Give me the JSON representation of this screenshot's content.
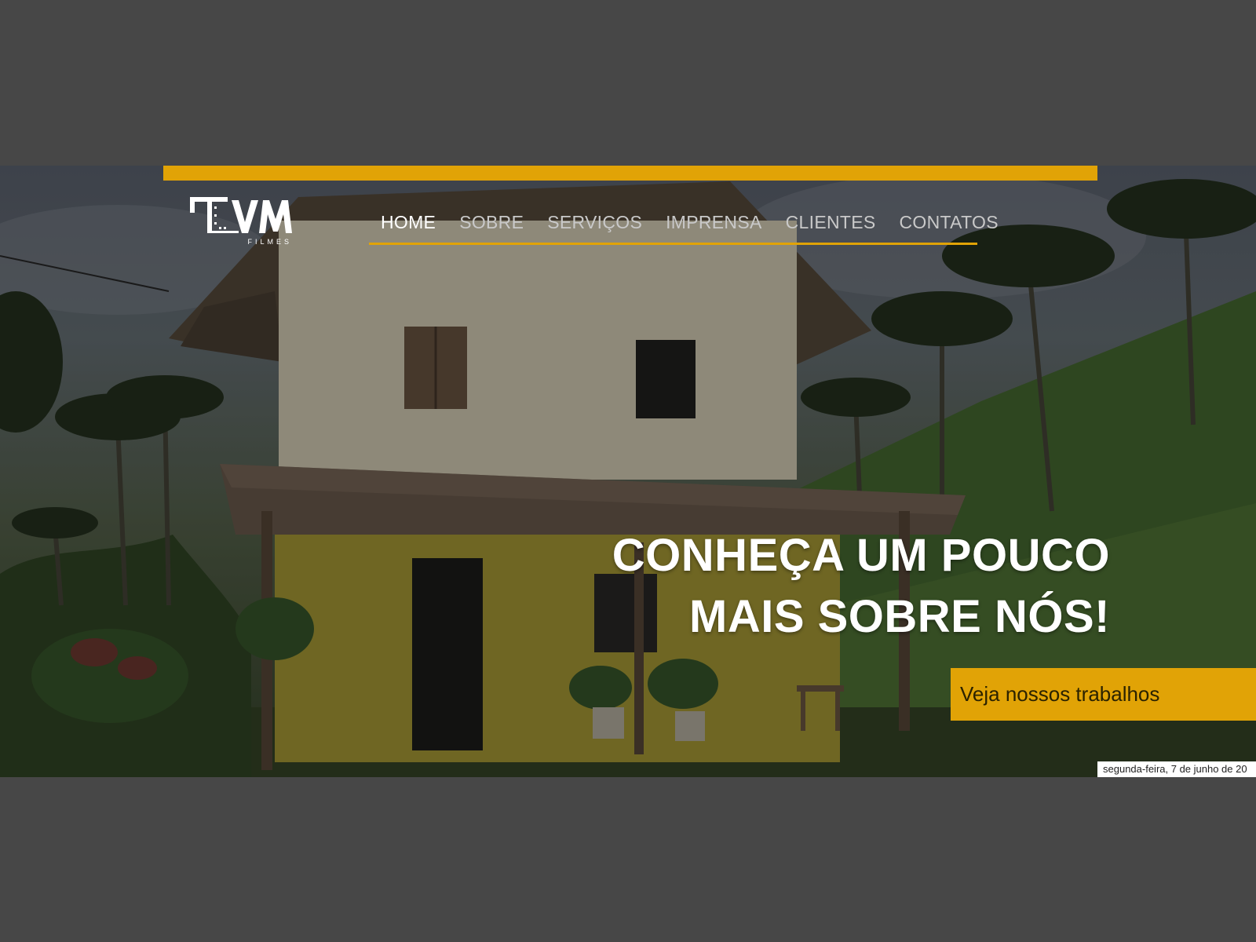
{
  "brand": {
    "logo_text": "VM",
    "logo_subtext": "FILMES"
  },
  "nav": {
    "items": [
      {
        "label": "HOME",
        "active": true
      },
      {
        "label": "SOBRE",
        "active": false
      },
      {
        "label": "SERVIÇOS",
        "active": false
      },
      {
        "label": "IMPRENSA",
        "active": false
      },
      {
        "label": "CLIENTES",
        "active": false
      },
      {
        "label": "CONTATOS",
        "active": false
      }
    ]
  },
  "hero": {
    "headline_line1": "CONHEÇA UM POUCO",
    "headline_line2": "MAIS SOBRE NÓS!",
    "cta_label": "Veja nossos trabalhos",
    "date_text": "segunda-feira, 7 de junho de 20"
  },
  "colors": {
    "accent": "#e1a306",
    "page_background": "#474747",
    "nav_text": "#c9c9c9",
    "nav_active": "#ffffff"
  }
}
